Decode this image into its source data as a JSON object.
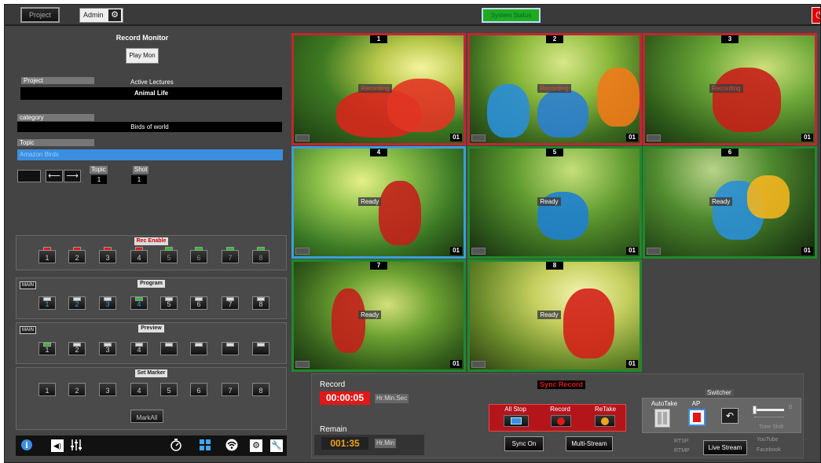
{
  "topbar": {
    "project_label": "Project",
    "admin_label": "Admin",
    "system_status": "System Status",
    "power_icon": "power-icon"
  },
  "record_monitor": {
    "title": "Record Monitor",
    "play_mon": "Play Mon",
    "project_label": "Project",
    "active_lectures_label": "Active Lectures",
    "project_value": "Animal Life",
    "category_label": "category",
    "category_value": "Birds of world",
    "topic_label": "Topic",
    "topic_value": "Amazon Birds",
    "topic_small_label": "Topic",
    "topic_small_value": "1",
    "shot_label": "Shot",
    "shot_value": "1"
  },
  "rec_enable": {
    "title": "Rec Enable",
    "buttons": [
      "1",
      "2",
      "3",
      "4",
      "5",
      "6",
      "7",
      "8"
    ],
    "indicators": [
      "red",
      "red",
      "red",
      "red",
      "green",
      "green",
      "green",
      "green"
    ]
  },
  "program": {
    "tag": "MAIN",
    "title": "Program",
    "buttons": [
      "1",
      "2",
      "3",
      "4",
      "5",
      "6",
      "7",
      "8"
    ],
    "active": 4
  },
  "preview": {
    "tag": "MAIN",
    "title": "Preview",
    "buttons": [
      "1",
      "2",
      "3",
      "4",
      "",
      "",
      "",
      ""
    ],
    "active": 1
  },
  "set_marker": {
    "title": "Set Marker",
    "buttons": [
      "1",
      "2",
      "3",
      "4",
      "5",
      "6",
      "7",
      "8"
    ],
    "mark_all": "MarkAll"
  },
  "tiles": [
    {
      "num": "1",
      "status": "Recording",
      "ch": "01",
      "state": "recording"
    },
    {
      "num": "2",
      "status": "Recording",
      "ch": "01",
      "state": "recording"
    },
    {
      "num": "3",
      "status": "Recording",
      "ch": "01",
      "state": "recording"
    },
    {
      "num": "4",
      "status": "Ready",
      "ch": "01",
      "state": "ready-blue"
    },
    {
      "num": "5",
      "status": "Ready",
      "ch": "01",
      "state": "ready-green"
    },
    {
      "num": "6",
      "status": "Ready",
      "ch": "01",
      "state": "ready-green"
    },
    {
      "num": "7",
      "status": "Ready",
      "ch": "01",
      "state": "ready-green"
    },
    {
      "num": "8",
      "status": "Ready",
      "ch": "01",
      "state": "ready-green"
    }
  ],
  "controls": {
    "record_label": "Record",
    "record_time": "00:00:05",
    "record_unit": "Hr.Min.Sec",
    "remain_label": "Remain",
    "remain_time": "001:35",
    "remain_unit": "Hr.Min",
    "sync_record": "Sync Record",
    "all_stop": "All Stop",
    "record": "Record",
    "retake": "ReTake",
    "sync_on": "Sync On",
    "multi_stream": "Multi-Stream",
    "switcher": "Switcher",
    "autotake": "AutoTake",
    "ap": "AP",
    "slider_value": "0",
    "time_shift": "Time Shift",
    "rtsp": "RTSP",
    "rtmp": "RTMP",
    "live_stream": "Live Stream",
    "youtube": "YouTube",
    "facebook": "Facebook"
  },
  "colors": {
    "recording_border": "#c2262d",
    "ready_blue_border": "#3b9fd9",
    "ready_green_border": "#1f8a2a",
    "timer_red": "#e01818",
    "remain_orange": "#f3a21a"
  }
}
